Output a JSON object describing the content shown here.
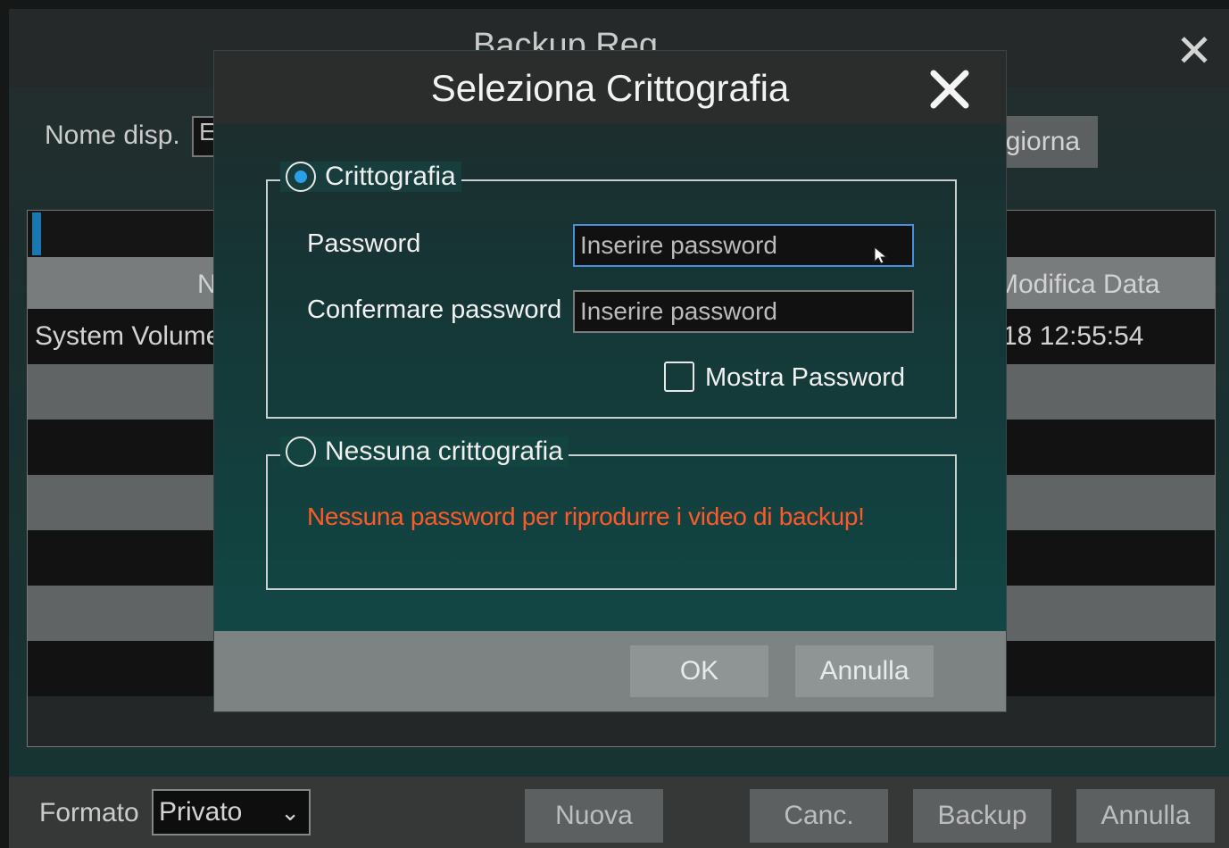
{
  "background": {
    "window_title": "Backup Reg",
    "device_label": "Nome disp.",
    "device_value": "E:",
    "refresh_label": "Aggiorna",
    "table": {
      "header_name": "Nome",
      "header_date": "Modifica Data",
      "rows": [
        {
          "name": "System Volume Information",
          "date": "18 12:55:54"
        }
      ]
    },
    "footer": {
      "format_label": "Formato",
      "format_value": "Privato",
      "buttons": [
        "Nuova",
        "Canc.",
        "Backup",
        "Annulla"
      ]
    }
  },
  "dialog": {
    "title": "Seleziona Crittografia",
    "encryption": {
      "label": "Crittografia",
      "selected": true,
      "password_label": "Password",
      "password_placeholder": "Inserire password",
      "confirm_label": "Confermare password",
      "confirm_placeholder": "Inserire password",
      "show_password_label": "Mostra Password",
      "show_password_checked": false
    },
    "no_encryption": {
      "label": "Nessuna crittografia",
      "selected": false,
      "warning": "Nessuna password per riprodurre i video di backup!"
    },
    "ok_label": "OK",
    "cancel_label": "Annulla"
  },
  "colors": {
    "accent_blue": "#2aa0e8",
    "warning_red": "#ff5b2a"
  }
}
